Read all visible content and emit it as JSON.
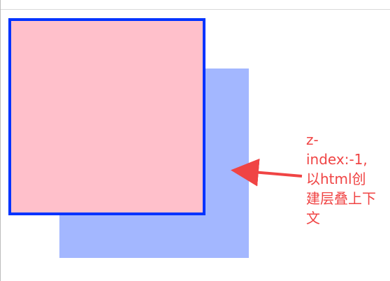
{
  "annotation": {
    "text": "z-\nindex:-1,\n以html创\n建层叠上下\n文"
  },
  "colors": {
    "back_box": "#a3b7ff",
    "front_box_fill": "#ffc0cb",
    "front_box_border": "#0033ff",
    "annotation": "#f04444"
  }
}
